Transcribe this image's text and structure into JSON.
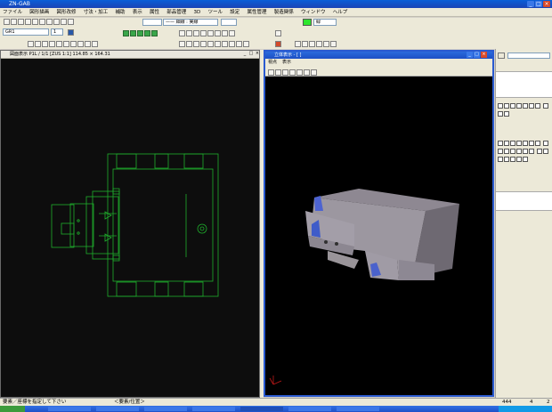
{
  "window": {
    "title": "ZN-GAB"
  },
  "menu": [
    "ファイル",
    "図形描画",
    "図形改修",
    "寸法・加工",
    "補助",
    "表示",
    "属性",
    "部品管理",
    "3D",
    "ツール",
    "設定",
    "属性管理",
    "製造関係",
    "ウィンドウ",
    "ヘルプ"
  ],
  "toolbar": {
    "layer_combo": "GR1",
    "number_combo": "1",
    "linetype_combo": "",
    "line_combo": "—— 細線 : 実線",
    "color_combo": "緑",
    "color_swatch": "#2ee62e"
  },
  "left_pane": {
    "title": "図面表示 P1L / 1/1 [ZUS 1:1] 114.85 × 164.31",
    "drawing_color": "#1fae2c"
  },
  "right_pane": {
    "title": "立体表示 - [ ]",
    "menu": [
      "視点",
      "表示"
    ]
  },
  "status": {
    "prompt": "要素／座標を指定して下さい",
    "hint": "＜要素/位置＞",
    "n1": "444",
    "n2": "4",
    "n3": "2"
  },
  "right_side_input": ""
}
